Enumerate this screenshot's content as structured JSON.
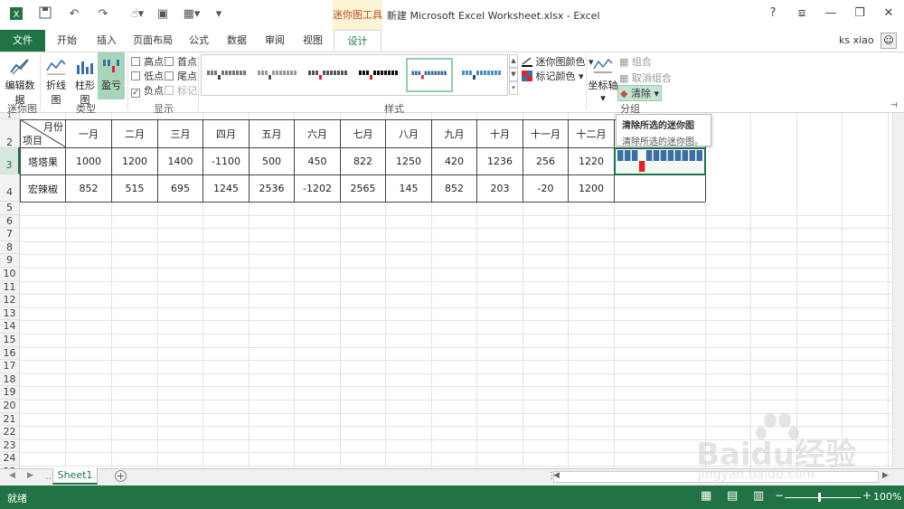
{
  "window": {
    "title": "新建 Microsoft Excel Worksheet.xlsx - Excel",
    "context_tab_title": "迷你图工具",
    "help": "?"
  },
  "tabs": {
    "file": "文件",
    "items": [
      "开始",
      "插入",
      "页面布局",
      "公式",
      "数据",
      "审阅",
      "视图"
    ],
    "design": "设计"
  },
  "user": {
    "name": "ks xiao"
  },
  "ribbon": {
    "sparkline_group": {
      "edit_data": "编辑数据",
      "label": "迷你图"
    },
    "type_group": {
      "line": "折线图",
      "column": "柱形图",
      "winloss": "盈亏",
      "label": "类型"
    },
    "show_group": {
      "label": "显示",
      "checks": [
        {
          "label": "高点",
          "checked": false,
          "disabled": false
        },
        {
          "label": "首点",
          "checked": false,
          "disabled": false
        },
        {
          "label": "低点",
          "checked": false,
          "disabled": false
        },
        {
          "label": "尾点",
          "checked": false,
          "disabled": false
        },
        {
          "label": "负点",
          "checked": true,
          "disabled": false
        },
        {
          "label": "标记",
          "checked": false,
          "disabled": true
        }
      ]
    },
    "style_group": {
      "label": "样式"
    },
    "color_group": {
      "sparkline_color": "迷你图颜色",
      "marker_color": "标记颜色"
    },
    "group_group": {
      "axis": "坐标轴",
      "group": "组合",
      "ungroup": "取消组合",
      "clear": "清除",
      "label": "分组"
    }
  },
  "tooltip": {
    "title": "清除所选的迷你图",
    "desc": "清除所选的迷你图。"
  },
  "sheet": {
    "row_numbers": [
      "1",
      "2",
      "3",
      "4",
      "5",
      "6",
      "7",
      "8",
      "9",
      "10",
      "11",
      "12",
      "13",
      "14",
      "15",
      "16",
      "17",
      "18",
      "19",
      "20",
      "21",
      "22",
      "23",
      "24",
      "25"
    ],
    "corner_top": "月份",
    "corner_bottom": "项目",
    "months": [
      "一月",
      "二月",
      "三月",
      "四月",
      "五月",
      "六月",
      "七月",
      "八月",
      "九月",
      "十月",
      "十一月",
      "十二月"
    ],
    "rows": [
      {
        "name": "塔塔果",
        "values": [
          "1000",
          "1200",
          "1400",
          "-1100",
          "500",
          "450",
          "822",
          "1250",
          "420",
          "1236",
          "256",
          "1220"
        ]
      },
      {
        "name": "宏辣椒",
        "values": [
          "852",
          "515",
          "695",
          "1245",
          "2536",
          "-1202",
          "2565",
          "145",
          "852",
          "203",
          "-20",
          "1200"
        ]
      }
    ],
    "sparkline_winloss": [
      1,
      1,
      1,
      -1,
      1,
      1,
      1,
      1,
      1,
      1,
      1,
      1
    ],
    "sheet_tab": "Sheet1"
  },
  "status": {
    "ready": "就绪",
    "zoom": "100%"
  },
  "colors": {
    "excel_green": "#217346",
    "bar_blue": "#3a6ea5",
    "bar_red": "#d9262c"
  },
  "watermark": {
    "text": "Baidu经验",
    "sub": "jingyan.baidu.com"
  }
}
